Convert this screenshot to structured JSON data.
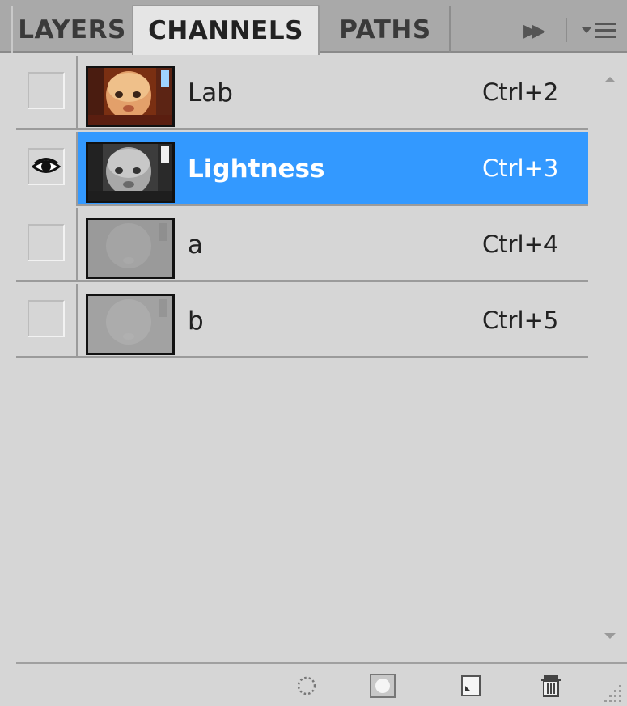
{
  "tabs": [
    {
      "label": "LAYERS",
      "active": false
    },
    {
      "label": "CHANNELS",
      "active": true
    },
    {
      "label": "PATHS",
      "active": false
    }
  ],
  "channels": [
    {
      "name": "Lab",
      "shortcut": "Ctrl+2",
      "visible": false,
      "selected": false
    },
    {
      "name": "Lightness",
      "shortcut": "Ctrl+3",
      "visible": true,
      "selected": true
    },
    {
      "name": "a",
      "shortcut": "Ctrl+4",
      "visible": false,
      "selected": false
    },
    {
      "name": "b",
      "shortcut": "Ctrl+5",
      "visible": false,
      "selected": false
    }
  ],
  "icons": {
    "expand": "fast-forward-icon",
    "menu": "panel-menu-icon",
    "visibility": "eye-icon",
    "load_selection": "dotted-circle-icon",
    "save_selection": "mask-icon",
    "new_channel": "new-page-icon",
    "delete_channel": "trash-icon",
    "resize": "resize-grip-icon"
  },
  "colors": {
    "selection": "#3399ff",
    "panel_bg": "#d6d6d6",
    "tabbar_bg": "#a9a9a9"
  }
}
